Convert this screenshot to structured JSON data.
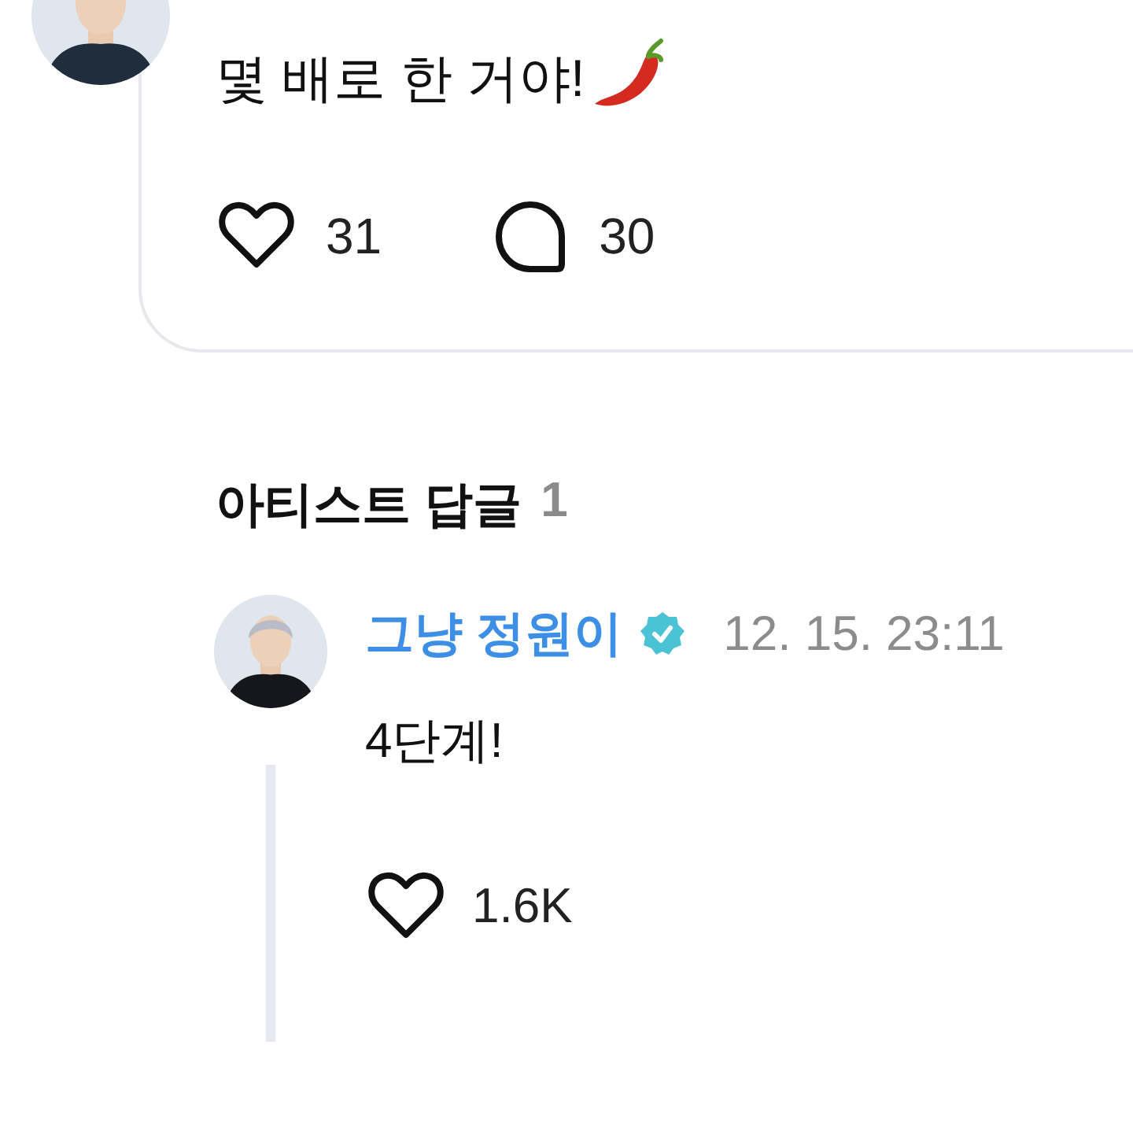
{
  "comment": {
    "text": "몇 배로 한 거야!",
    "likes": "31",
    "replies": "30"
  },
  "artist_replies": {
    "title": "아티스트 답글",
    "count": "1",
    "items": [
      {
        "author": "그냥 정원이",
        "verified": true,
        "time": "12. 15. 23:11",
        "text": "4단계!",
        "likes": "1.6K"
      }
    ]
  }
}
